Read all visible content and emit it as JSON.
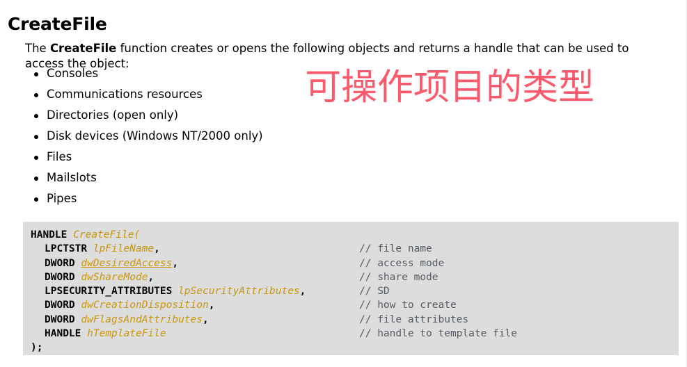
{
  "document": {
    "title": "CreateFile",
    "intro": {
      "before": "The ",
      "bold": "CreateFile",
      "after": " function creates or opens the following objects and returns a handle that can be used to access the object:"
    },
    "object_list": [
      "Consoles",
      "Communications resources",
      "Directories (open only)",
      "Disk devices (Windows NT/2000 only)",
      "Files",
      "Mailslots",
      "Pipes"
    ],
    "annotation": {
      "text": "可操作项目的类型",
      "color": "#fa5a6c"
    },
    "code": {
      "background": "#dddddd",
      "keyword_color": "#000000",
      "param_color": "#c8960c",
      "comment_color": "#555b63",
      "lines": [
        {
          "indent": 0,
          "type": "HANDLE",
          "name": "CreateFile(",
          "punct": "",
          "comment": ""
        },
        {
          "indent": 1,
          "type": "LPCTSTR",
          "name": "lpFileName",
          "punct": ",",
          "comment": "// file name",
          "link": false
        },
        {
          "indent": 1,
          "type": "DWORD",
          "name": "dwDesiredAccess",
          "punct": ",",
          "comment": "// access mode",
          "link": true
        },
        {
          "indent": 1,
          "type": "DWORD",
          "name": "dwShareMode",
          "punct": ",",
          "comment": "// share mode",
          "link": false
        },
        {
          "indent": 1,
          "type": "LPSECURITY_ATTRIBUTES",
          "name": "lpSecurityAttributes",
          "punct": ",",
          "comment": "// SD",
          "link": false
        },
        {
          "indent": 1,
          "type": "DWORD",
          "name": "dwCreationDisposition",
          "punct": ",",
          "comment": "// how to create",
          "link": false
        },
        {
          "indent": 1,
          "type": "DWORD",
          "name": "dwFlagsAndAttributes",
          "punct": ",",
          "comment": "// file attributes",
          "link": false
        },
        {
          "indent": 1,
          "type": "HANDLE",
          "name": "hTemplateFile",
          "punct": "",
          "comment": "// handle to template file",
          "link": false
        },
        {
          "indent": 0,
          "type": "",
          "name": "",
          "punct": ");",
          "comment": ""
        }
      ]
    }
  }
}
